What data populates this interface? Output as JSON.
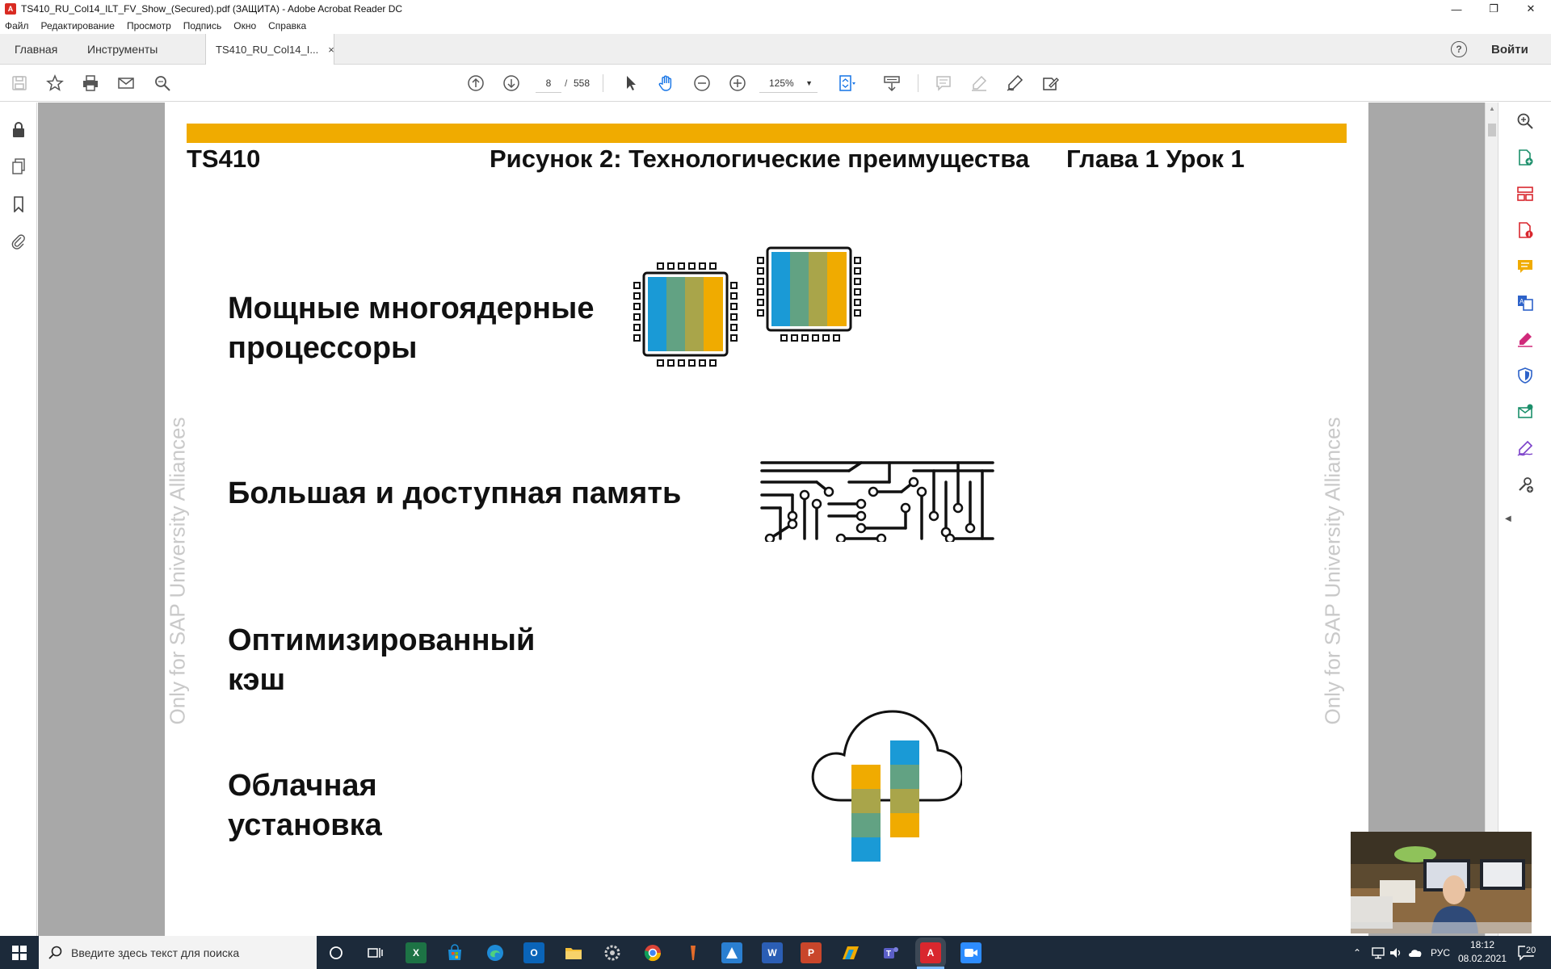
{
  "window": {
    "title": "TS410_RU_Col14_ILT_FV_Show_(Secured).pdf (ЗАЩИТА) - Adobe Acrobat Reader DC",
    "app_icon": "adobe-reader-icon"
  },
  "menubar": {
    "items": [
      "Файл",
      "Редактирование",
      "Просмотр",
      "Подпись",
      "Окно",
      "Справка"
    ]
  },
  "tabs": {
    "home": "Главная",
    "tools": "Инструменты",
    "document": "TS410_RU_Col14_I...",
    "close_glyph": "×",
    "signin": "Войти",
    "help_glyph": "?"
  },
  "toolbar": {
    "current_page": "8",
    "page_separator": "/",
    "total_pages": "558",
    "zoom": "125%"
  },
  "page": {
    "header_left": "TS410",
    "header_center": "Рисунок 2: Технологические преимущества",
    "header_right": "Глава 1 Урок 1",
    "watermark": "Only for SAP University Alliances",
    "features": [
      {
        "line1": "Мощные многоядерные",
        "line2": "процессоры"
      },
      {
        "line1": "Большая и доступная память",
        "line2": ""
      },
      {
        "line1": "Оптимизированный",
        "line2": "кэш"
      },
      {
        "line1": "Облачная",
        "line2": "установка"
      }
    ],
    "colors": {
      "banner": "#f0ab00",
      "blue": "#1a9ad6",
      "teal": "#62a283",
      "olive": "#a9a54a",
      "gold": "#f0ab00"
    }
  },
  "taskbar": {
    "search_placeholder": "Введите здесь текст для поиска",
    "language": "РУС",
    "time": "18:12",
    "date": "08.02.2021",
    "notifications": "20"
  }
}
